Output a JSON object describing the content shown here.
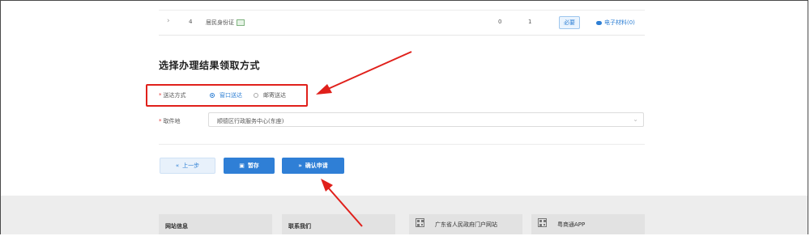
{
  "document_row": {
    "index": "4",
    "name": "居民身份证",
    "count_a": "0",
    "count_b": "1",
    "required_badge": "必要",
    "material_link": "电子材料(0)"
  },
  "section": {
    "title": "选择办理结果领取方式"
  },
  "delivery": {
    "required_mark": "*",
    "label": "送达方式",
    "options": [
      {
        "label": "窗口送达",
        "selected": true
      },
      {
        "label": "邮寄送达",
        "selected": false
      }
    ]
  },
  "pickup": {
    "required_mark": "*",
    "label": "取件地",
    "value": "顺德区行政服务中心(东座)"
  },
  "buttons": {
    "prev": "上一步",
    "save": "暂存",
    "confirm": "确认申请"
  },
  "footer": {
    "site_info": "网站信息",
    "contact": "联系我们",
    "portal": "广东省人民政府门户网站",
    "app": "粤商通APP"
  },
  "colors": {
    "accent": "#2f7fd6",
    "highlight": "#e0201b",
    "footer_bg": "#ededed"
  }
}
